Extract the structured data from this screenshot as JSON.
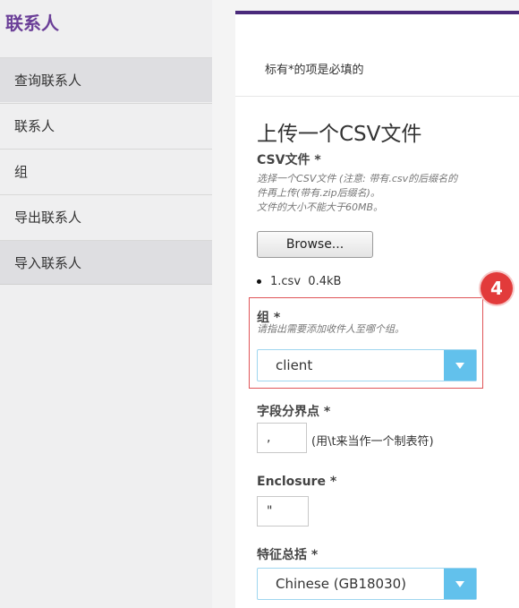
{
  "sidebar": {
    "title": "联系人",
    "items": [
      {
        "label": "查询联系人"
      },
      {
        "label": "联系人"
      },
      {
        "label": "组"
      },
      {
        "label": "导出联系人"
      },
      {
        "label": "导入联系人"
      }
    ]
  },
  "form": {
    "required_note": "标有*的项是必填的",
    "section_title": "上传一个CSV文件",
    "csv": {
      "label": "CSV文件 *",
      "hint_lines": [
        "选择一个CSV文件 (注意:  带有.csv的后缀名的",
        "件再上传(带有.zip后缀名)。",
        "文件的大小不能大于60MB。"
      ],
      "browse_label": "Browse...",
      "file_name": "1.csv",
      "file_size": "0.4kB"
    },
    "group": {
      "label": "组 *",
      "hint": "请指出需要添加收件人至哪个组。",
      "value": "client"
    },
    "delimiter": {
      "label": "字段分界点 *",
      "value": ",",
      "note": "(用\\t来当作一个制表符)"
    },
    "enclosure": {
      "label": "Enclosure *",
      "value": "\""
    },
    "charset": {
      "label": "特征总括 *",
      "value": "Chinese (GB18030)"
    }
  },
  "annotation": {
    "step_number": "4",
    "color": "#e23b3b"
  },
  "colors": {
    "brand_purple": "#6b3f98",
    "topbar": "#4a2a7b",
    "select_arrow": "#62c1ec"
  }
}
